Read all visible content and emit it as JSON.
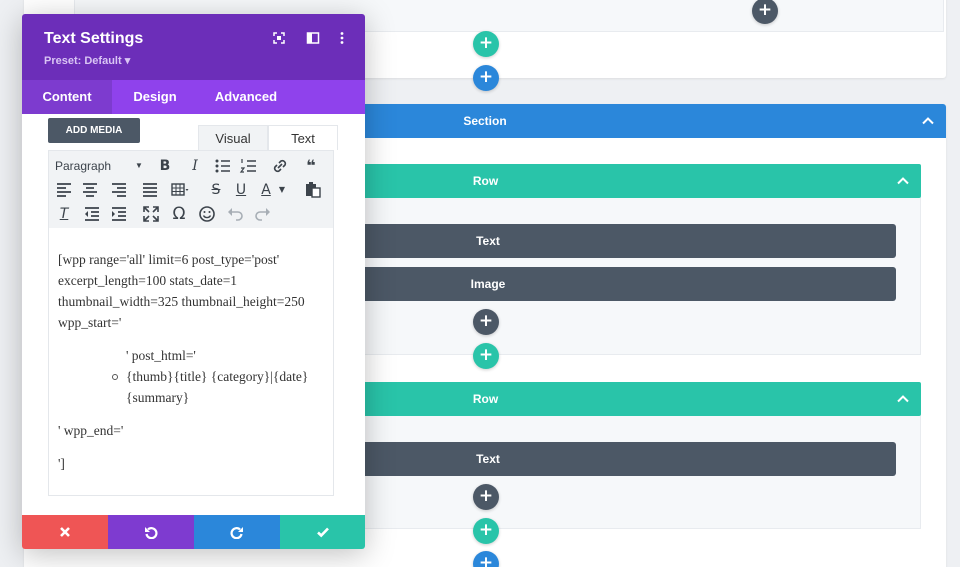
{
  "colors": {
    "section": "#2b87da",
    "row": "#29c4a9",
    "module": "#4c5866",
    "modal_header": "#6c2eb9",
    "modal_tabs": "#8f42ec",
    "cancel": "#ef5555",
    "undo": "#7e3bd0",
    "redo": "#2b87da",
    "save": "#29c4a9"
  },
  "modal": {
    "title": "Text Settings",
    "preset": "Preset: Default ▾",
    "header_icons": [
      "fullscreen-icon",
      "sidebar-icon",
      "more-options-icon"
    ],
    "tabs": [
      {
        "label": "Content",
        "active": true
      },
      {
        "label": "Design",
        "active": false
      },
      {
        "label": "Advanced",
        "active": false
      }
    ],
    "add_media_label": "ADD MEDIA",
    "editor_tabs": [
      {
        "label": "Visual",
        "active": true
      },
      {
        "label": "Text",
        "active": false
      }
    ],
    "format_select": "Paragraph",
    "content": {
      "p1": "[wpp range='all' limit=6 post_type='post' excerpt_length=100 stats_date=1 thumbnail_width=325 thumbnail_height=250 wpp_start='",
      "list_line1": "' post_html='",
      "list_line2": "{thumb}{title} {category}|{date} {summary}",
      "p2": "' wpp_end='",
      "p3": "']"
    },
    "footer_icons": [
      "cancel-icon",
      "undo-icon",
      "redo-icon",
      "save-icon"
    ]
  },
  "canvas": {
    "section_label": "Section",
    "rows": [
      {
        "label": "Row",
        "modules": [
          "Text",
          "Image"
        ]
      },
      {
        "label": "Row",
        "modules": [
          "Text"
        ]
      }
    ],
    "add_symbol": "+"
  }
}
